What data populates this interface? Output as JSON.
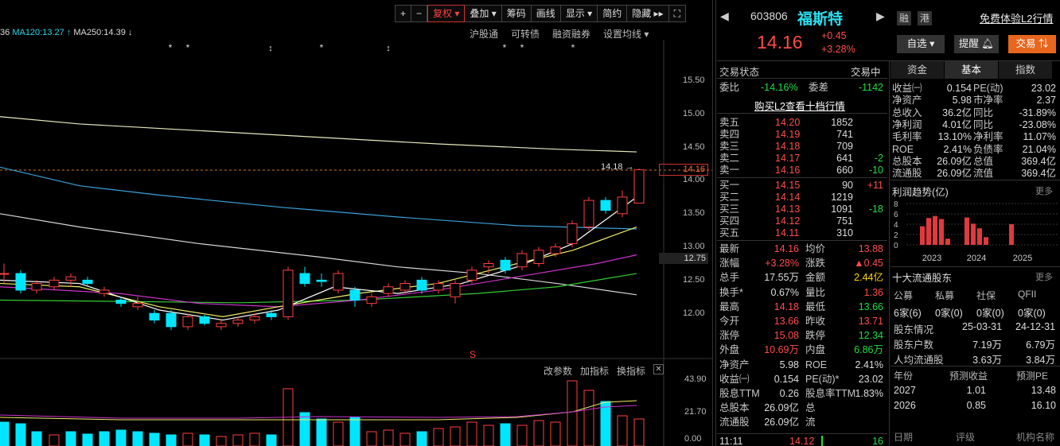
{
  "toolbar": {
    "items": [
      "+",
      "−",
      "复权",
      "叠加",
      "筹码",
      "画线",
      "显示",
      "简约",
      "隐藏"
    ]
  },
  "ma_line": {
    "prefix": "36",
    "ma120": "MA120:13.27",
    "ma250": "MA250:14.39"
  },
  "chart_links": [
    "沪股通",
    "可转债",
    "融资融券",
    "设置均线"
  ],
  "price_axis": [
    "15.50",
    "15.00",
    "14.50",
    "14.00",
    "13.50",
    "13.00",
    "12.50",
    "12.00"
  ],
  "price_tag": "14.16",
  "price_tag2": "12.75",
  "hi_label": "14.18",
  "vol_header": [
    "改参数",
    "加指标",
    "换指标"
  ],
  "vol_axis": [
    "43.90",
    "21.70",
    "0.00"
  ],
  "stock": {
    "code": "603806",
    "name": "福斯特",
    "badges": [
      "融",
      "港"
    ],
    "l2_link": "免费体验L2行情",
    "price": "14.16",
    "change": "+0.45",
    "pct": "+3.28%",
    "watch": "自选",
    "alert": "提醒",
    "trade": "交易"
  },
  "status": {
    "label": "交易状态",
    "value": "交易中"
  },
  "weibi": {
    "l1": "委比",
    "v1": "-14.16%",
    "l2": "委差",
    "v2": "-1142"
  },
  "buy_l2": "购买L2查看十档行情",
  "asks": [
    {
      "n": "卖五",
      "p": "14.20",
      "v": "1852",
      "d": ""
    },
    {
      "n": "卖四",
      "p": "14.19",
      "v": "741",
      "d": ""
    },
    {
      "n": "卖三",
      "p": "14.18",
      "v": "709",
      "d": ""
    },
    {
      "n": "卖二",
      "p": "14.17",
      "v": "641",
      "d": "-2"
    },
    {
      "n": "卖一",
      "p": "14.16",
      "v": "660",
      "d": "-10"
    }
  ],
  "bids": [
    {
      "n": "买一",
      "p": "14.15",
      "v": "90",
      "d": "+11"
    },
    {
      "n": "买二",
      "p": "14.14",
      "v": "1219",
      "d": ""
    },
    {
      "n": "买三",
      "p": "14.13",
      "v": "1091",
      "d": "-18"
    },
    {
      "n": "买四",
      "p": "14.12",
      "v": "751",
      "d": ""
    },
    {
      "n": "买五",
      "p": "14.11",
      "v": "310",
      "d": ""
    }
  ],
  "quote": [
    [
      "最新",
      "14.16",
      "均价",
      "13.88"
    ],
    [
      "涨幅",
      "+3.28%",
      "涨跌",
      "▲0.45"
    ],
    [
      "总手",
      "17.55万",
      "金额",
      "2.44亿"
    ],
    [
      "换手*",
      "0.67%",
      "量比",
      "1.36"
    ],
    [
      "最高",
      "14.18",
      "最低",
      "13.66"
    ],
    [
      "今开",
      "13.66",
      "昨收",
      "13.71"
    ],
    [
      "涨停",
      "15.08",
      "跌停",
      "12.34"
    ],
    [
      "外盘",
      "10.69万",
      "内盘",
      "6.86万"
    ],
    [
      "净资产",
      "5.98",
      "ROE",
      "2.41%"
    ],
    [
      "收益㈠",
      "0.154",
      "PE(动)*",
      "23.02"
    ],
    [
      "股息TTM",
      "0.26",
      "股息率TTM",
      "1.83%"
    ],
    [
      "总股本",
      "26.09亿",
      "总",
      ""
    ],
    [
      "流通股",
      "26.09亿",
      "流",
      ""
    ]
  ],
  "tick": {
    "time": "11:11",
    "price": "14.12",
    "vol": "16"
  },
  "ftabs": [
    "资金",
    "基本",
    "指数"
  ],
  "fund": [
    [
      "收益㈠",
      "0.154",
      "PE(动)",
      "23.02"
    ],
    [
      "净资产",
      "5.98",
      "市净率",
      "2.37"
    ],
    [
      "总收入",
      "36.2亿",
      "同比",
      "-31.89%"
    ],
    [
      "净利润",
      "4.01亿",
      "同比",
      "-23.08%"
    ],
    [
      "毛利率",
      "13.10%",
      "净利率",
      "11.07%"
    ],
    [
      "ROE",
      "2.41%",
      "负债率",
      "21.04%"
    ],
    [
      "总股本",
      "26.09亿",
      "总值",
      "369.4亿"
    ],
    [
      "流通股",
      "26.09亿",
      "流值",
      "369.4亿"
    ]
  ],
  "profit": {
    "title": "利润趋势(亿)",
    "more": "更多",
    "yticks": [
      "8",
      "6",
      "4",
      "2",
      "0"
    ],
    "years": [
      "2023",
      "2024",
      "2025"
    ],
    "values": [
      3.6,
      5.2,
      5.6,
      5.0,
      1.2,
      5.3,
      4.1,
      3.2,
      1.5,
      4.0
    ]
  },
  "holders": {
    "title": "十大流通股东",
    "more": "更多",
    "cols": [
      "公募",
      "私募",
      "社保",
      "QFII"
    ],
    "vals": [
      "6家(6)",
      "0家(0)",
      "0家(0)",
      "0家(0)"
    ],
    "rows": [
      [
        "股东情况",
        "25-03-31",
        "24-12-31"
      ],
      [
        "股东户数",
        "7.19万",
        "6.79万"
      ],
      [
        "人均流通股",
        "3.63万",
        "3.84万"
      ]
    ]
  },
  "forecast": {
    "cols": [
      "年份",
      "预测收益",
      "预测PE"
    ],
    "rows": [
      [
        "2027",
        "1.01",
        "13.48"
      ],
      [
        "2026",
        "0.85",
        "16.10"
      ]
    ],
    "foot": [
      "日期",
      "评级",
      "机构名称"
    ]
  }
}
